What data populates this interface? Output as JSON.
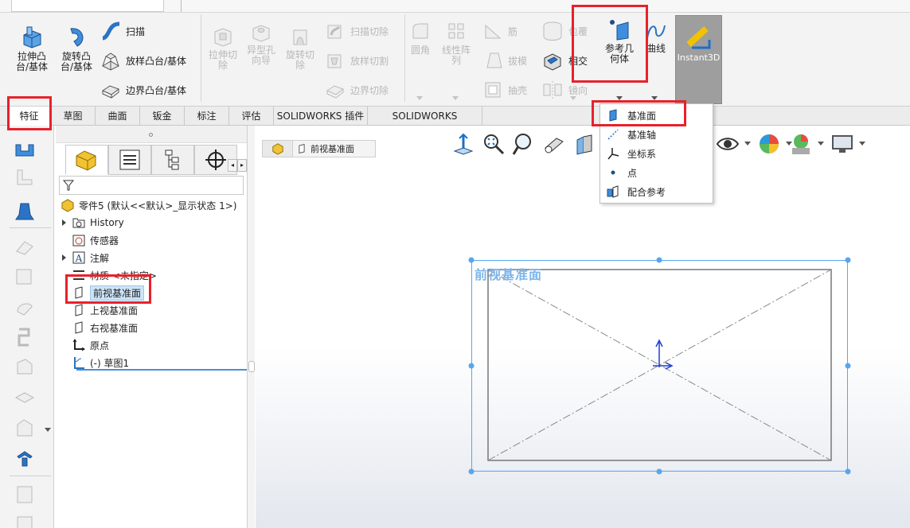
{
  "ribbon": {
    "extrude_boss": "拉伸凸\n台/基体",
    "revolve_boss": "旋转凸\n台/基体",
    "sweep": "扫描",
    "loft_boss": "放样凸台/基体",
    "boundary_boss": "边界凸台/基体",
    "extrude_cut": "拉伸切\n除",
    "hole_wizard": "异型孔\n向导",
    "revolve_cut": "旋转切\n除",
    "swept_cut": "扫描切除",
    "lofted_cut": "放样切割",
    "boundary_cut": "边界切除",
    "fillet": "圆角",
    "linear_pattern": "线性阵\n列",
    "rib": "筋",
    "draft": "拔模",
    "shell": "抽壳",
    "wrap": "包覆",
    "intersect": "相交",
    "mirror": "镜向",
    "reference_geometry": "参考几\n何体",
    "curves": "曲线",
    "instant3d": "Instant3D"
  },
  "tabs": [
    "特征",
    "草图",
    "曲面",
    "钣金",
    "标注",
    "评估",
    "SOLIDWORKS 插件",
    "SOLIDWORKS Inspection"
  ],
  "tree": {
    "part": "零件5 (默认<<默认>_显示状态 1>)",
    "history": "History",
    "sensors": "传感器",
    "annotations": "注解",
    "material": "材质 <未指定>",
    "front_plane": "前视基准面",
    "top_plane": "上视基准面",
    "right_plane": "右视基准面",
    "origin": "原点",
    "sketch": "(-) 草图1"
  },
  "breadcrumb": "前视基准面",
  "menu": {
    "plane": "基准面",
    "axis": "基准轴",
    "coordinate_system": "坐标系",
    "point": "点",
    "mate_reference": "配合参考"
  },
  "view_label": "前视基准面",
  "colors": {
    "highlight": "#e8212b",
    "selection": "#58a6ef",
    "plane_label": "#7db5ea",
    "accent_blue": "#1f6fc5"
  }
}
